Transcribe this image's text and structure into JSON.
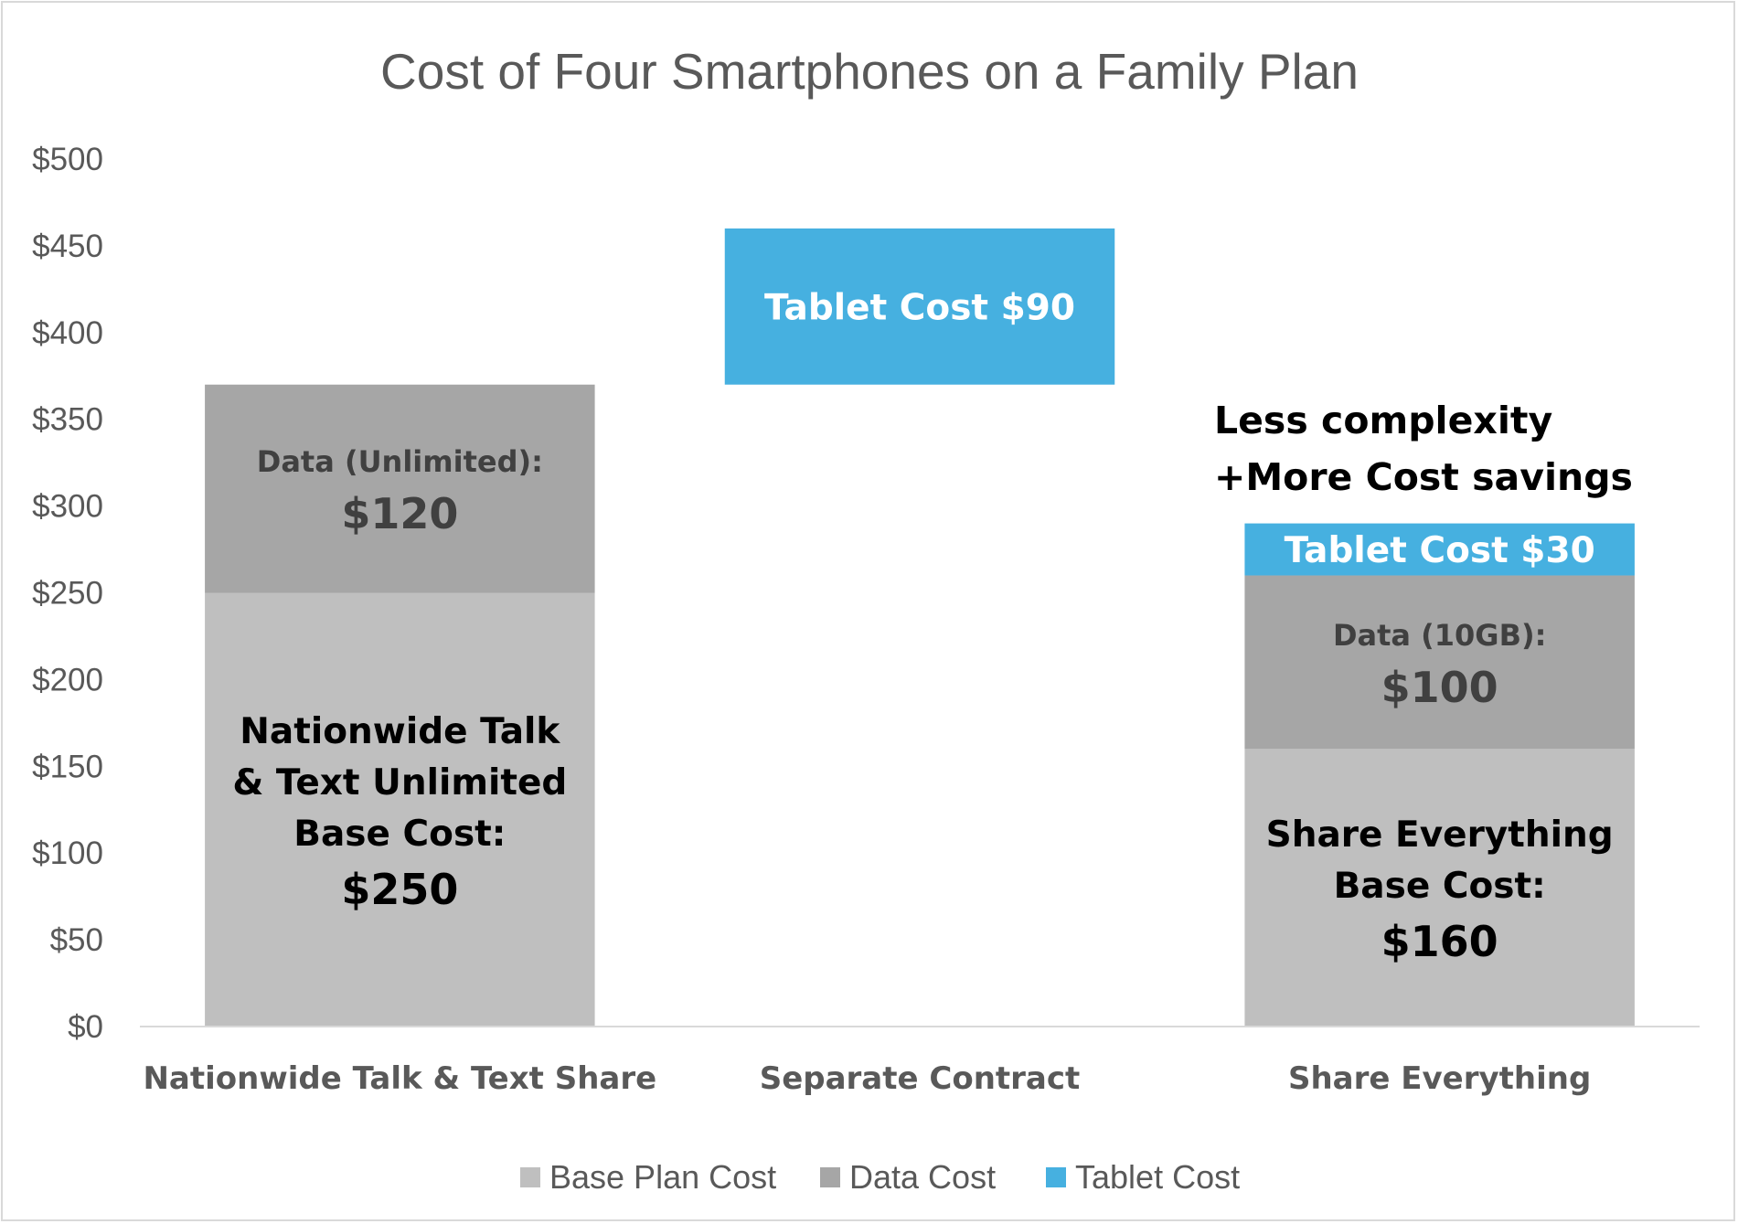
{
  "chart_data": {
    "type": "bar",
    "stacked": true,
    "title": "Cost of Four Smartphones on a Family Plan",
    "xlabel": "",
    "ylabel": "",
    "ylim": [
      0,
      500
    ],
    "y_ticks": [
      "$0",
      "$50",
      "$100",
      "$150",
      "$200",
      "$250",
      "$300",
      "$350",
      "$400",
      "$450",
      "$500"
    ],
    "grid": false,
    "legend_position": "bottom",
    "categories": [
      "Nationwide Talk & Text Share",
      "Separate Contract",
      "Share Everything"
    ],
    "series": [
      {
        "name": "Base Plan Cost",
        "color": "#bfbfbf",
        "values": [
          250,
          0,
          160
        ],
        "starts": [
          0,
          0,
          0
        ]
      },
      {
        "name": "Data Cost",
        "color": "#a6a6a6",
        "values": [
          120,
          0,
          100
        ],
        "starts": [
          250,
          0,
          160
        ]
      },
      {
        "name": "Tablet Cost",
        "color": "#46b0e0",
        "values": [
          0,
          90,
          30
        ],
        "starts": [
          0,
          370,
          260
        ]
      }
    ],
    "segment_labels": [
      {
        "category": 0,
        "series": 0,
        "lines": [
          "Nationwide Talk",
          "& Text Unlimited",
          "Base Cost:"
        ],
        "value_text": "$250",
        "color": "#000000"
      },
      {
        "category": 0,
        "series": 1,
        "lines": [
          "Data (Unlimited):"
        ],
        "value_text": "$120",
        "color": "#404040"
      },
      {
        "category": 1,
        "series": 2,
        "lines": [
          "Tablet Cost $90"
        ],
        "value_text": "",
        "color": "#ffffff"
      },
      {
        "category": 2,
        "series": 0,
        "lines": [
          "Share Everything",
          "Base Cost:"
        ],
        "value_text": "$160",
        "color": "#000000"
      },
      {
        "category": 2,
        "series": 1,
        "lines": [
          "Data (10GB):"
        ],
        "value_text": "$100",
        "color": "#404040"
      },
      {
        "category": 2,
        "series": 2,
        "lines": [
          "Tablet Cost $30"
        ],
        "value_text": "",
        "color": "#ffffff"
      }
    ],
    "annotation": [
      "Less complexity",
      "+More Cost savings"
    ]
  }
}
